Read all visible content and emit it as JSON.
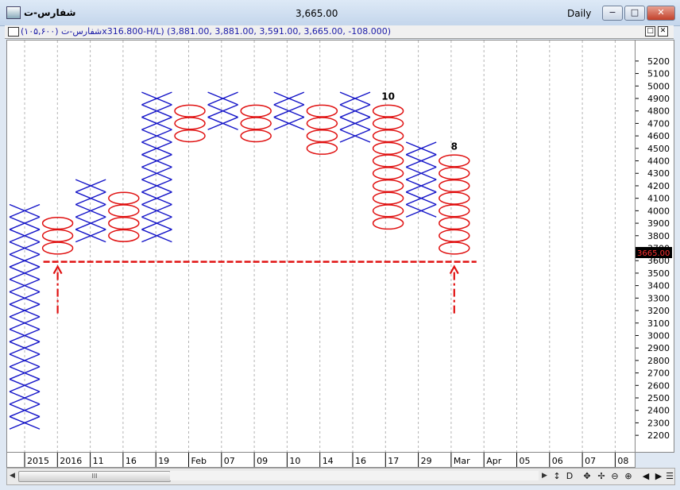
{
  "window": {
    "title": "شفارس-ت",
    "price": "3,665.00",
    "period": "Daily",
    "buttons": {
      "minimize": "−",
      "maximize": "□",
      "close": "✕"
    }
  },
  "infobar": {
    "text": "شفارس-ت (۱۰۵,۶۰۰)x316.800-H/L) (3,881.00, 3,881.00, 3,591.00, 3,665.00, -108.000)",
    "buttons": {
      "restore": "□",
      "close": "✕"
    }
  },
  "scrollbar": {
    "thumb_label": "III",
    "tools": [
      "↕",
      "D",
      "✥",
      "✢",
      "⊖",
      "⊕",
      "◀",
      "▶",
      "☰"
    ]
  },
  "colors": {
    "x": "#1414c8",
    "o": "#e01010",
    "annotation": "#e01010",
    "grid": "#b4b4b4"
  },
  "chart_data": {
    "type": "point-and-figure",
    "box_size": 100,
    "y_ticks": [
      2200,
      2300,
      2400,
      2500,
      2600,
      2700,
      2800,
      2900,
      3000,
      3100,
      3200,
      3300,
      3400,
      3500,
      3600,
      3700,
      3800,
      3900,
      4000,
      4100,
      4200,
      4300,
      4400,
      4500,
      4600,
      4700,
      4800,
      4900,
      5000,
      5100,
      5200
    ],
    "ylim": [
      2150,
      5250
    ],
    "x_labels": [
      "2015",
      "2016",
      "11",
      "16",
      "19",
      "Feb",
      "07",
      "09",
      "10",
      "14",
      "16",
      "17",
      "29",
      "Mar",
      "Apr",
      "05",
      "06",
      "07",
      "08"
    ],
    "columns": [
      {
        "type": "X",
        "low": 2300,
        "high": 4000
      },
      {
        "type": "O",
        "low": 3700,
        "high": 3900
      },
      {
        "type": "X",
        "low": 3800,
        "high": 4200
      },
      {
        "type": "O",
        "low": 3800,
        "high": 4100
      },
      {
        "type": "X",
        "low": 3800,
        "high": 4900
      },
      {
        "type": "O",
        "low": 4600,
        "high": 4800
      },
      {
        "type": "X",
        "low": 4700,
        "high": 4900
      },
      {
        "type": "O",
        "low": 4600,
        "high": 4800
      },
      {
        "type": "X",
        "low": 4700,
        "high": 4900
      },
      {
        "type": "O",
        "low": 4500,
        "high": 4800
      },
      {
        "type": "X",
        "low": 4600,
        "high": 4900
      },
      {
        "type": "O",
        "low": 3900,
        "high": 4800
      },
      {
        "type": "X",
        "low": 4000,
        "high": 4500
      },
      {
        "type": "O",
        "low": 3700,
        "high": 4400
      }
    ],
    "column_labels": [
      {
        "column": 11,
        "text": "10"
      },
      {
        "column": 13,
        "text": "8"
      }
    ],
    "last_price": {
      "value": 3665,
      "label": "3665.00"
    },
    "support_line": 3591
  }
}
